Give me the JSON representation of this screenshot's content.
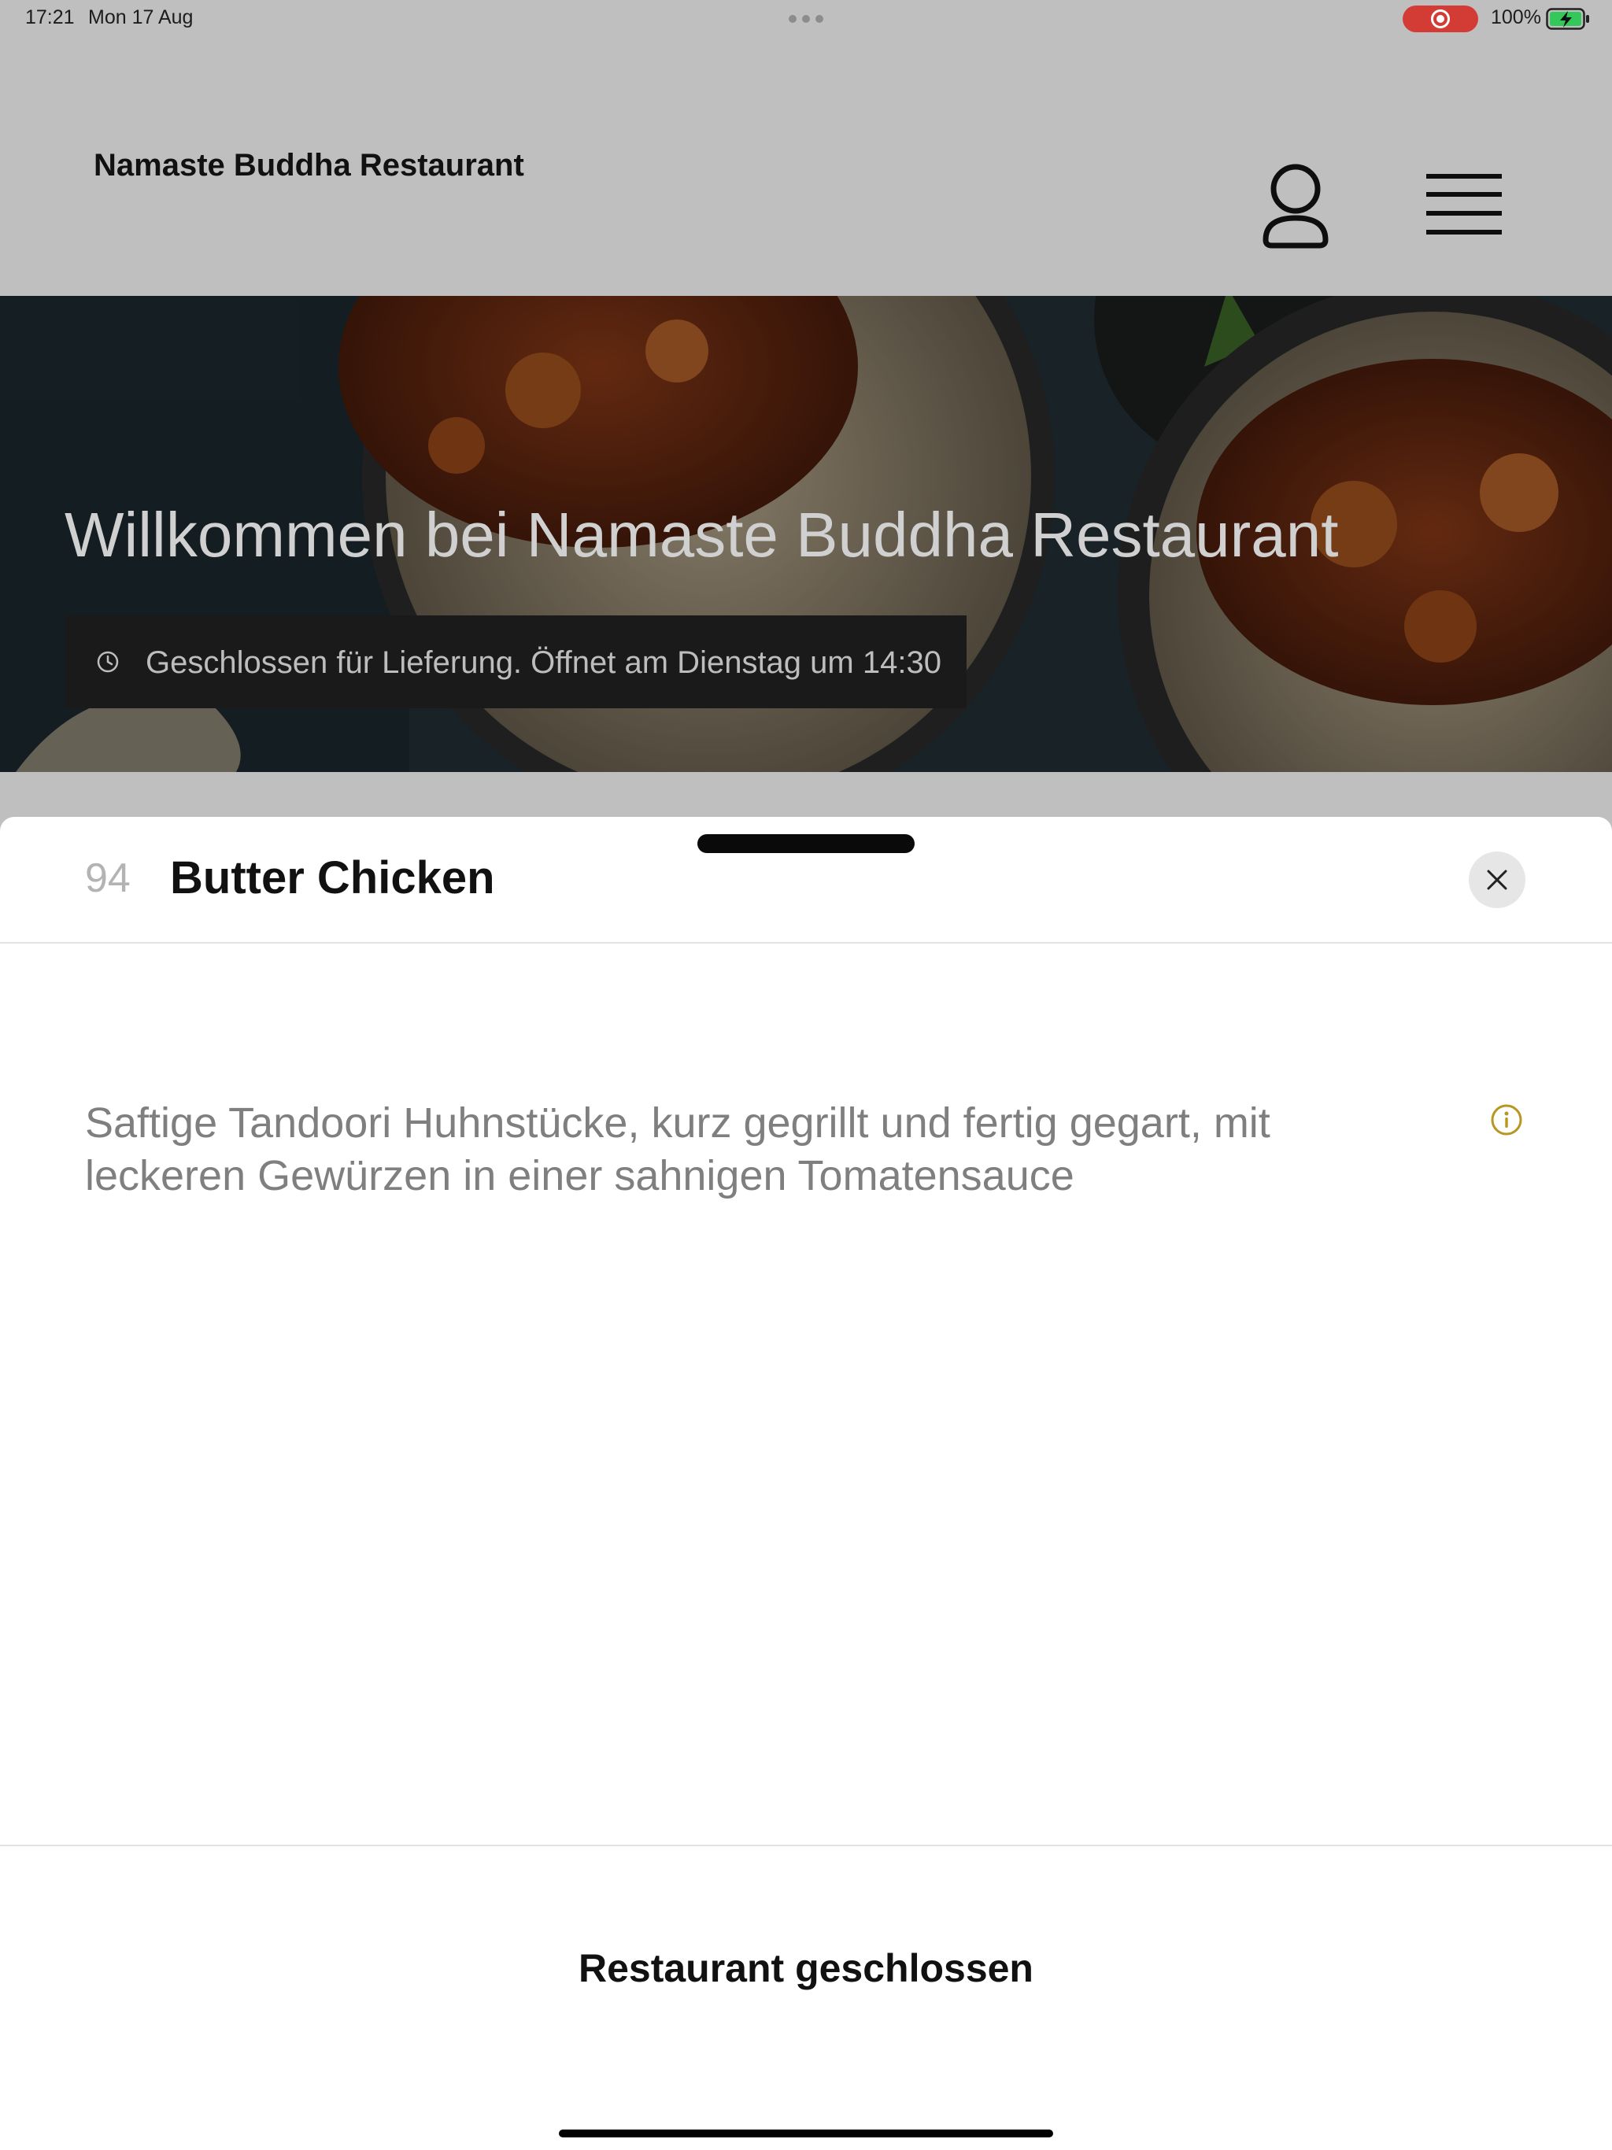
{
  "status_bar": {
    "time": "17:21",
    "date": "Mon 17 Aug",
    "battery": "100%",
    "icons": [
      "multitasking-dots-icon",
      "screen-recording-icon",
      "battery-charging-icon"
    ]
  },
  "header": {
    "title": "Namaste Buddha Restaurant",
    "icons": [
      "account-icon",
      "menu-icon"
    ]
  },
  "hero": {
    "title": "Willkommen bei Namaste Buddha Restaurant",
    "status_text": "Geschlossen für Lieferung. Öffnet am Dienstag um 14:30",
    "icons": [
      "clock-icon"
    ]
  },
  "dish": {
    "number": "94",
    "name": "Butter Chicken",
    "description": "Saftige Tandoori Huhnstücke, kurz gegrillt und fertig gegart, mit leckeren Gewürzen in einer sahnigen Tomatensauce",
    "icons": [
      "close-icon",
      "info-icon"
    ]
  },
  "footer": {
    "closed_label": "Restaurant geschlossen"
  },
  "colors": {
    "overlay_gray": "#bfbfbf",
    "hero_title": "#d0d0d0",
    "recording_red": "#d33c34",
    "battery_green": "#34c759",
    "info_accent": "#b8961f",
    "description_gray": "#7f7f7f"
  }
}
